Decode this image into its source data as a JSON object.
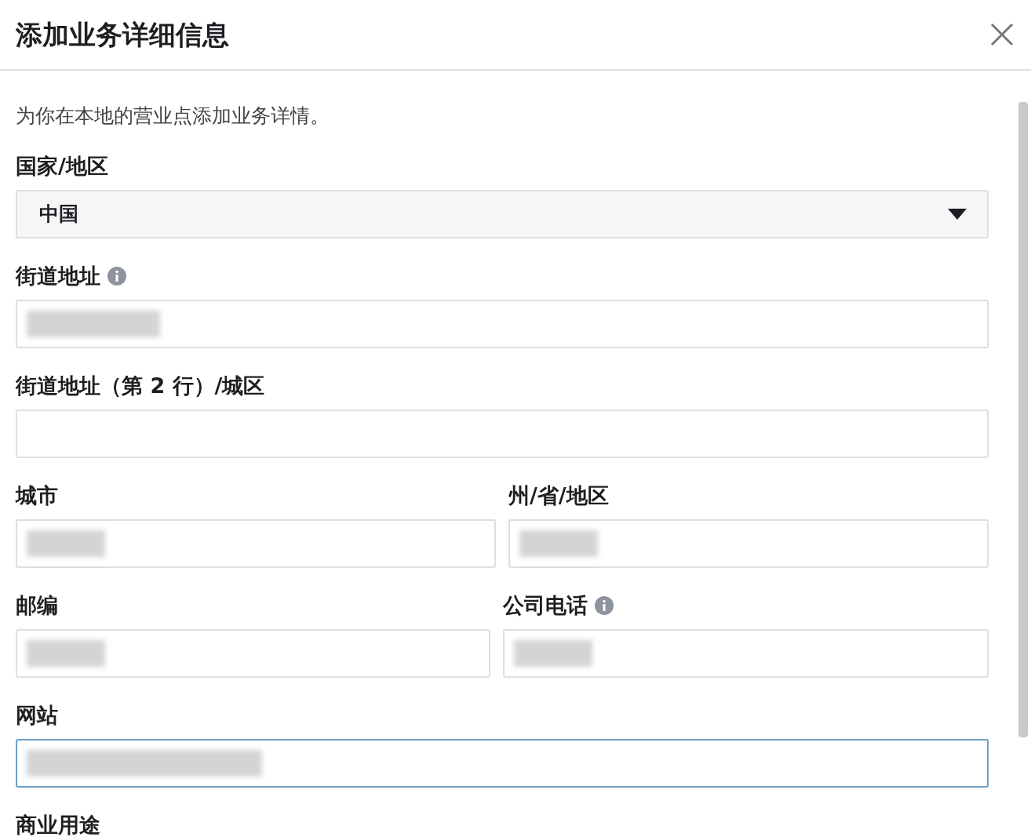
{
  "dialog": {
    "title": "添加业务详细信息",
    "description": "为你在本地的营业点添加业务详情。"
  },
  "rows": [
    [
      {
        "label": "国家/地区",
        "kind": "select",
        "value": "中国"
      }
    ],
    [
      {
        "label": "街道地址",
        "info": true,
        "kind": "text",
        "redacted": true
      }
    ],
    [
      {
        "label": "街道地址（第 2 行）/城区",
        "kind": "text"
      }
    ],
    [
      {
        "label": "城市",
        "kind": "text",
        "redacted": true
      },
      {
        "label": "州/省/地区",
        "kind": "text",
        "redacted": true
      }
    ],
    [
      {
        "label": "邮编",
        "kind": "text",
        "redacted": true
      },
      {
        "label": "公司电话",
        "info": true,
        "kind": "text",
        "redacted": true
      }
    ],
    [
      {
        "label": "网站",
        "kind": "text",
        "redacted": true,
        "focused": true
      }
    ],
    [
      {
        "label": "商业用途",
        "kind": "label"
      }
    ]
  ]
}
